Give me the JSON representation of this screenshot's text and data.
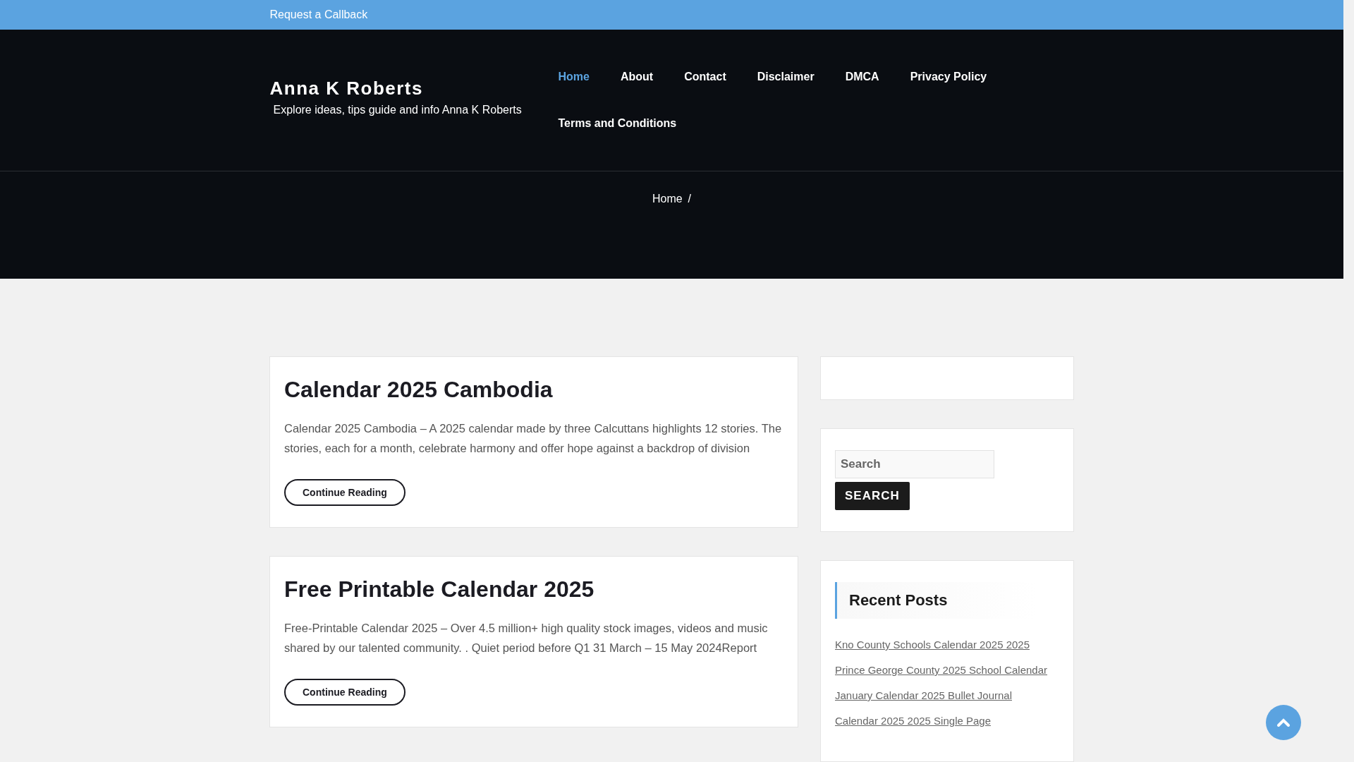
{
  "top_bar": {
    "link": "Request a Callback"
  },
  "header": {
    "site_title": "Anna K Roberts",
    "tagline": "Explore ideas, tips guide and info Anna K Roberts",
    "nav": [
      {
        "label": "Home",
        "selected": true
      },
      {
        "label": "About",
        "selected": false
      },
      {
        "label": "Contact",
        "selected": false
      },
      {
        "label": "Disclaimer",
        "selected": false
      },
      {
        "label": "DMCA",
        "selected": false
      },
      {
        "label": "Privacy Policy",
        "selected": false
      },
      {
        "label": "Terms and Conditions",
        "selected": false
      }
    ]
  },
  "breadcrumb": {
    "items": [
      "Home"
    ],
    "separator": "/"
  },
  "posts": [
    {
      "title": "Calendar 2025 Cambodia",
      "excerpt": "Calendar 2025 Cambodia – A 2025 calendar made by three Calcuttans highlights 12 stories. The stories, each for a month, celebrate harmony and offer hope against a backdrop of division",
      "button": "Continue Reading"
    },
    {
      "title": "Free Printable Calendar 2025",
      "excerpt": "Free-Printable Calendar 2025 – Over 4.5 million+ high quality stock images, videos and music shared by our talented community. . Quiet period before Q1 31 March – 15 May 2024Report",
      "button": "Continue Reading"
    }
  ],
  "sidebar": {
    "search": {
      "placeholder": "Search",
      "button": "SEARCH"
    },
    "recent_posts": {
      "title": "Recent Posts",
      "items": [
        "Kno County Schools Calendar 2025 2025",
        "Prince George County 2025 School Calendar",
        "January Calendar 2025 Bullet Journal",
        "Calendar 2025 2025 Single Page"
      ]
    }
  }
}
